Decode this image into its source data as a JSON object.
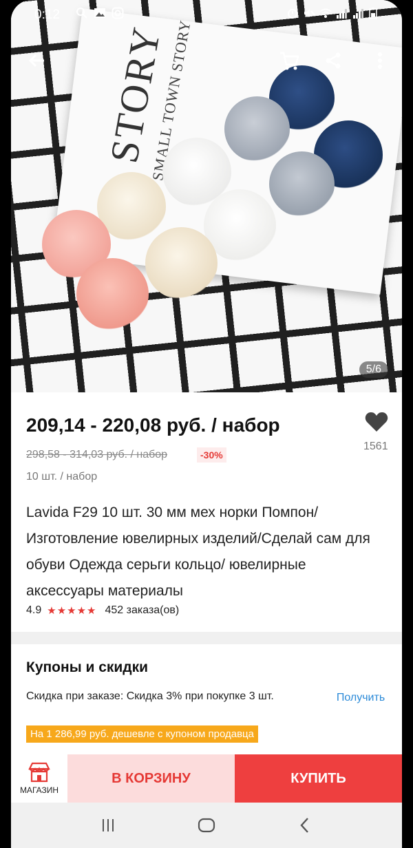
{
  "status_bar": {
    "time": "0:12",
    "left_icons": [
      "search-icon",
      "image-icon",
      "instagram-icon"
    ],
    "right_icons": [
      "alarm-icon",
      "mute-icon",
      "wifi-icon",
      "signal-icon",
      "signal-icon",
      "battery-icon"
    ]
  },
  "gallery": {
    "card_title": "STORY",
    "card_subtitle": "SMALL TOWN STORY",
    "counter": "5/6"
  },
  "product": {
    "price": "209,14 - 220,08 руб. / набор",
    "old_price": "298,58 - 314,03 руб. / набор",
    "discount": "-30%",
    "unit": "10 шт. / набор",
    "likes": "1561",
    "title": "Lavida F29 10 шт. 30 мм мех норки Помпон/ Изготовление ювелирных изделий/Сделай сам для обуви Одежда серьги кольцо/ ювелирные аксессуары материалы",
    "rating": "4.9",
    "stars": "★★★★★",
    "orders": "452 заказа(ов)"
  },
  "coupons": {
    "heading": "Купоны и скидки",
    "text": "Скидка при заказе: Скидка 3% при покупке 3 шт.",
    "get_label": "Получить",
    "banner": "На 1 286,99 руб. дешевле с купоном продавца"
  },
  "actions": {
    "shop_label": "МАГАЗИН",
    "cart_label": "В КОРЗИНУ",
    "buy_label": "КУПИТЬ"
  },
  "colors": {
    "accent_red": "#ee3f3f",
    "cart_bg": "#fcdcdc",
    "coupon_orange": "#f7a81b",
    "link_blue": "#2b8ad8"
  }
}
